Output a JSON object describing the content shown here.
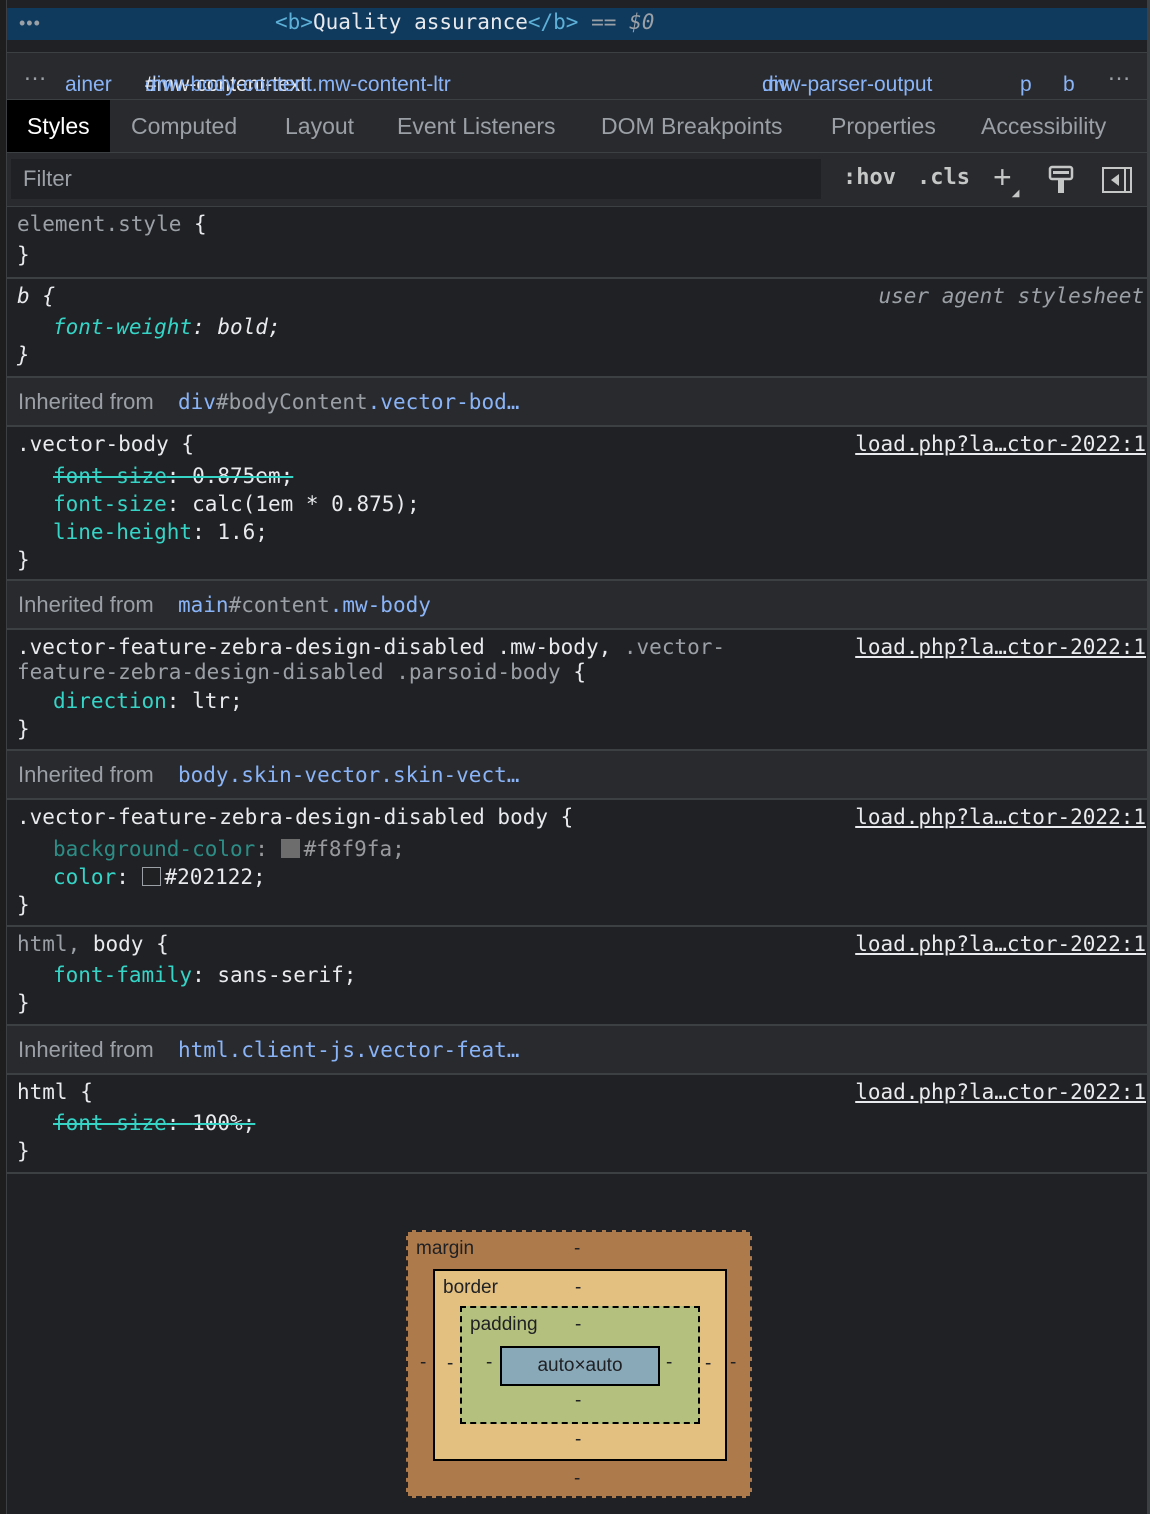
{
  "dom": {
    "ellipsis": "•••",
    "open_tag": "<b>",
    "text": "Quality assurance",
    "close_tag": "</b>",
    "eq": "==",
    "ref": "$0"
  },
  "breadcrumb": {
    "more_left": "…",
    "items": [
      {
        "el": "ainer",
        "id": "",
        "cls": ""
      },
      {
        "el": "div",
        "id": "#mw-content-text",
        "cls": ".mw-body-content.mw-content-ltr"
      },
      {
        "el": "div",
        "id": "",
        "cls": ".mw-parser-output"
      },
      {
        "el": "p",
        "id": "",
        "cls": ""
      },
      {
        "el": "b",
        "id": "",
        "cls": ""
      }
    ],
    "more_right": "…"
  },
  "tabs": [
    "Styles",
    "Computed",
    "Layout",
    "Event Listeners",
    "DOM Breakpoints",
    "Properties",
    "Accessibility"
  ],
  "filter": {
    "placeholder": "Filter",
    "hov": ":hov",
    "cls": ".cls",
    "icons": [
      "plus-icon",
      "paint-format-icon",
      "toggle-sidebar-icon"
    ]
  },
  "rules": {
    "element_style": {
      "selector": "element.style",
      "open": "{",
      "close": "}"
    },
    "b": {
      "selector": "b",
      "open": "{",
      "source": "user agent stylesheet",
      "prop": "font-weight",
      "value": "bold;",
      "close": "}"
    },
    "inherited_1": {
      "label": "Inherited from",
      "el": "div",
      "rest": "#bodyContent",
      "cls": ".vector-bod…"
    },
    "vector_body": {
      "selector": ".vector-body",
      "open": "{",
      "source": "load.php?la…ctor-2022:1",
      "decls": [
        {
          "prop": "font-size",
          "value": "0.875em;"
        },
        {
          "prop": "font-size",
          "value": "calc(1em * 0.875);"
        },
        {
          "prop": "line-height",
          "value": "1.6;"
        }
      ],
      "close": "}"
    },
    "inherited_2": {
      "label": "Inherited from",
      "el": "main",
      "rest": "#content",
      "cls": ".mw-body"
    },
    "zebra_body": {
      "selector_main": ".vector-feature-zebra-design-disabled .mw-body,",
      "selector_dim_1": ".vector-",
      "selector_dim_2": "feature-zebra-design-disabled .parsoid-body",
      "open": "{",
      "source": "load.php?la…ctor-2022:1",
      "prop": "direction",
      "value": "ltr;",
      "close": "}"
    },
    "inherited_3": {
      "label": "Inherited from",
      "el": "body",
      "rest": "",
      "cls": ".skin-vector.skin-vect…"
    },
    "zebra_bodytag": {
      "selector": ".vector-feature-zebra-design-disabled body",
      "open": "{",
      "source": "load.php?la…ctor-2022:1",
      "decls": [
        {
          "prop": "background-color",
          "value": "#f8f9fa;",
          "swatch": "#f8f9fa"
        },
        {
          "prop": "color",
          "value": "#202122;",
          "swatch": "#202122"
        }
      ],
      "close": "}"
    },
    "html_body": {
      "selector_dim": "html,",
      "selector_main": "body",
      "open": "{",
      "source": "load.php?la…ctor-2022:1",
      "prop": "font-family",
      "value": "sans-serif;",
      "close": "}"
    },
    "inherited_4": {
      "label": "Inherited from",
      "el": "html",
      "rest": "",
      "cls": ".client-js.vector-feat…"
    },
    "html": {
      "selector": "html",
      "open": "{",
      "source": "load.php?la…ctor-2022:1",
      "prop": "font-size",
      "value": "100%;",
      "close": "}"
    }
  },
  "box_model": {
    "margin_label": "margin",
    "border_label": "border",
    "padding_label": "padding",
    "content": "auto×auto",
    "dash": "-"
  }
}
